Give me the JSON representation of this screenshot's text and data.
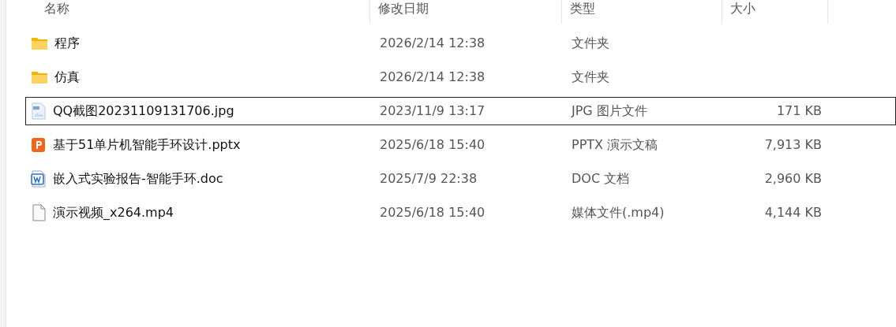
{
  "columns": [
    "名称",
    "修改日期",
    "类型",
    "大小"
  ],
  "rows": [
    {
      "kind": "folder",
      "name": "程序",
      "modified": "2026/2/14 12:38",
      "type": "文件夹",
      "focused": false
    },
    {
      "kind": "folder",
      "name": "仿真",
      "modified": "2026/2/14 12:38",
      "type": "文件夹",
      "focused": false
    },
    {
      "kind": "image",
      "name": "QQ截图20231109131706.jpg",
      "modified": "2023/11/9 13:17",
      "type": "JPG 图片文件",
      "size": "171 KB",
      "focused": true
    },
    {
      "kind": "slides",
      "name": "基于51单片机智能手环设计.pptx",
      "modified": "2025/6/18 15:40",
      "type": "PPTX 演示文稿",
      "size": "7,913 KB",
      "focused": false
    },
    {
      "kind": "document",
      "name": "嵌入式实验报告-智能手环.doc",
      "modified": "2025/7/9 22:38",
      "type": "DOC 文档",
      "size": "2,960 KB",
      "focused": false
    },
    {
      "kind": "file",
      "name": "演示视频_x264.mp4",
      "modified": "2025/6/18 15:40",
      "type": "媒体文件(.mp4)",
      "size": "4,144 KB",
      "focused": false
    }
  ]
}
